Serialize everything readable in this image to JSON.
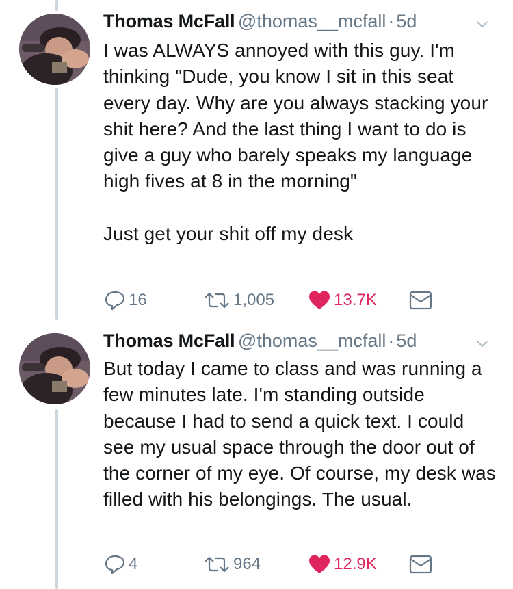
{
  "tweets": [
    {
      "name": "Thomas McFall",
      "handle": "@thomas__mcfall",
      "separator": "·",
      "time": "5d",
      "text": "I was ALWAYS annoyed with this guy. I'm thinking \"Dude, you know I sit in this seat every day. Why are you always stacking your shit here? And the last thing I want to do is give a guy who barely speaks my language high fives at 8 in the morning\"\n\nJust get your shit off my desk",
      "replies": "16",
      "retweets": "1,005",
      "likes": "13.7K"
    },
    {
      "name": "Thomas McFall",
      "handle": "@thomas__mcfall",
      "separator": "·",
      "time": "5d",
      "text": "But today I came to class and was running a few minutes late. I'm standing outside because I had to send a quick text. I could see my usual space through the door out of the corner of my eye. Of course, my desk was filled with his belongings. The usual.",
      "replies": "4",
      "retweets": "964",
      "likes": "12.9K"
    }
  ],
  "colors": {
    "text": "#14171a",
    "muted": "#657786",
    "like": "#e0245e",
    "thread_line": "#ccd6dd"
  },
  "icons": [
    "reply-icon",
    "retweet-icon",
    "heart-icon",
    "direct-message-icon",
    "chevron-down-icon"
  ]
}
